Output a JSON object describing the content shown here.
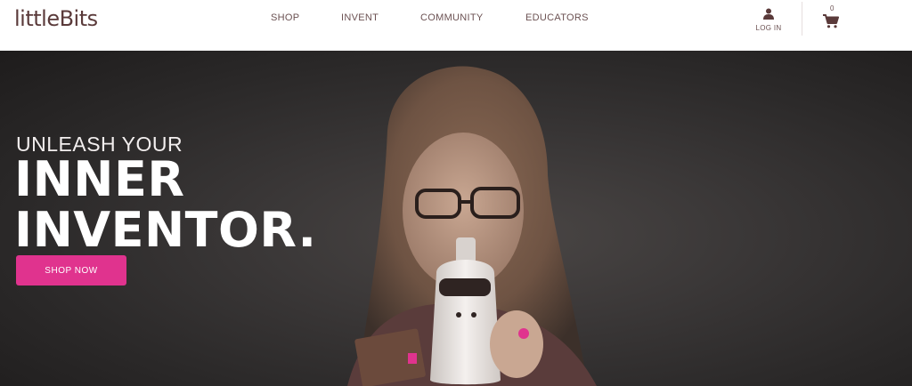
{
  "brand": {
    "logo_text": "littleBits"
  },
  "nav": {
    "items": [
      {
        "label": "SHOP"
      },
      {
        "label": "INVENT"
      },
      {
        "label": "COMMUNITY"
      },
      {
        "label": "EDUCATORS"
      }
    ]
  },
  "account": {
    "login_label": "LOG IN",
    "cart_count": "0"
  },
  "hero": {
    "kicker": "UNLEASH YOUR",
    "headline_line1": "INNER",
    "headline_line2": "INVENTOR.",
    "cta_label": "SHOP NOW"
  },
  "colors": {
    "accent": "#e0338e",
    "brand_text": "#5a3a3a",
    "hero_bg": "#2a2828"
  },
  "icons": [
    "user-icon",
    "cart-icon"
  ]
}
